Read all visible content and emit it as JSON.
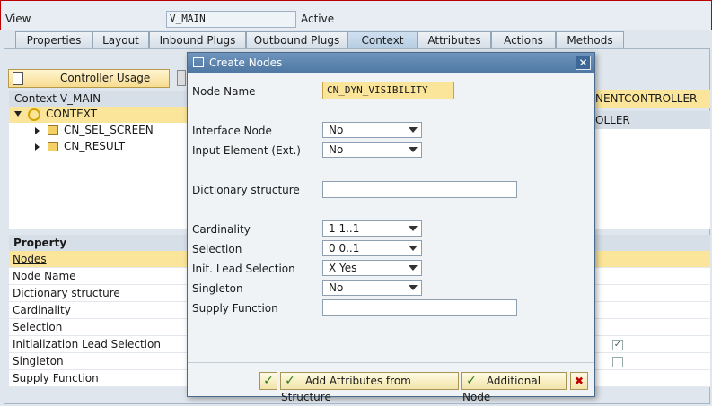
{
  "header": {
    "view_label": "View",
    "view_value": "V_MAIN",
    "status": "Active"
  },
  "tabs": [
    {
      "label": "Properties"
    },
    {
      "label": "Layout"
    },
    {
      "label": "Inbound Plugs"
    },
    {
      "label": "Outbound Plugs"
    },
    {
      "label": "Context",
      "active": true
    },
    {
      "label": "Attributes"
    },
    {
      "label": "Actions"
    },
    {
      "label": "Methods"
    }
  ],
  "left_panel": {
    "controller_usage_button": "Controller Usage",
    "context_header": "Context V_MAIN",
    "tree": [
      {
        "label": "CONTEXT",
        "level": 0
      },
      {
        "label": "CN_SEL_SCREEN",
        "level": 1
      },
      {
        "label": "CN_RESULT",
        "level": 1
      }
    ],
    "property_header": "Property",
    "properties": [
      "Nodes",
      "Node Name",
      "Dictionary structure",
      "Cardinality",
      "Selection",
      "Initialization Lead Selection",
      "Singleton",
      "Supply Function"
    ]
  },
  "right_panel": {
    "header_1": "NENTCONTROLLER",
    "header_2": "OLLER",
    "checkboxes": [
      {
        "checked": true
      },
      {
        "checked": false
      }
    ]
  },
  "dialog": {
    "title": "Create Nodes",
    "fields": {
      "node_name_label": "Node Name",
      "node_name_value": "CN_DYN_VISIBILITY",
      "interface_node_label": "Interface Node",
      "interface_node_value": "No",
      "input_element_label": "Input Element (Ext.)",
      "input_element_value": "No",
      "dictionary_structure_label": "Dictionary structure",
      "dictionary_structure_value": "",
      "cardinality_label": "Cardinality",
      "cardinality_value": "1 1..1",
      "selection_label": "Selection",
      "selection_value": "0 0..1",
      "init_lead_selection_label": "Init. Lead Selection",
      "init_lead_selection_value": "X Yes",
      "singleton_label": "Singleton",
      "singleton_value": "No",
      "supply_function_label": "Supply Function",
      "supply_function_value": ""
    },
    "buttons": {
      "add_attributes": "Add Attributes from Structure",
      "additional_node": "Additional Node"
    }
  },
  "colors": {
    "accent_yellow": "#fbe59a",
    "title_blue": "#4f77a3",
    "check_green": "#2b7a16",
    "cancel_red": "#c00000"
  }
}
